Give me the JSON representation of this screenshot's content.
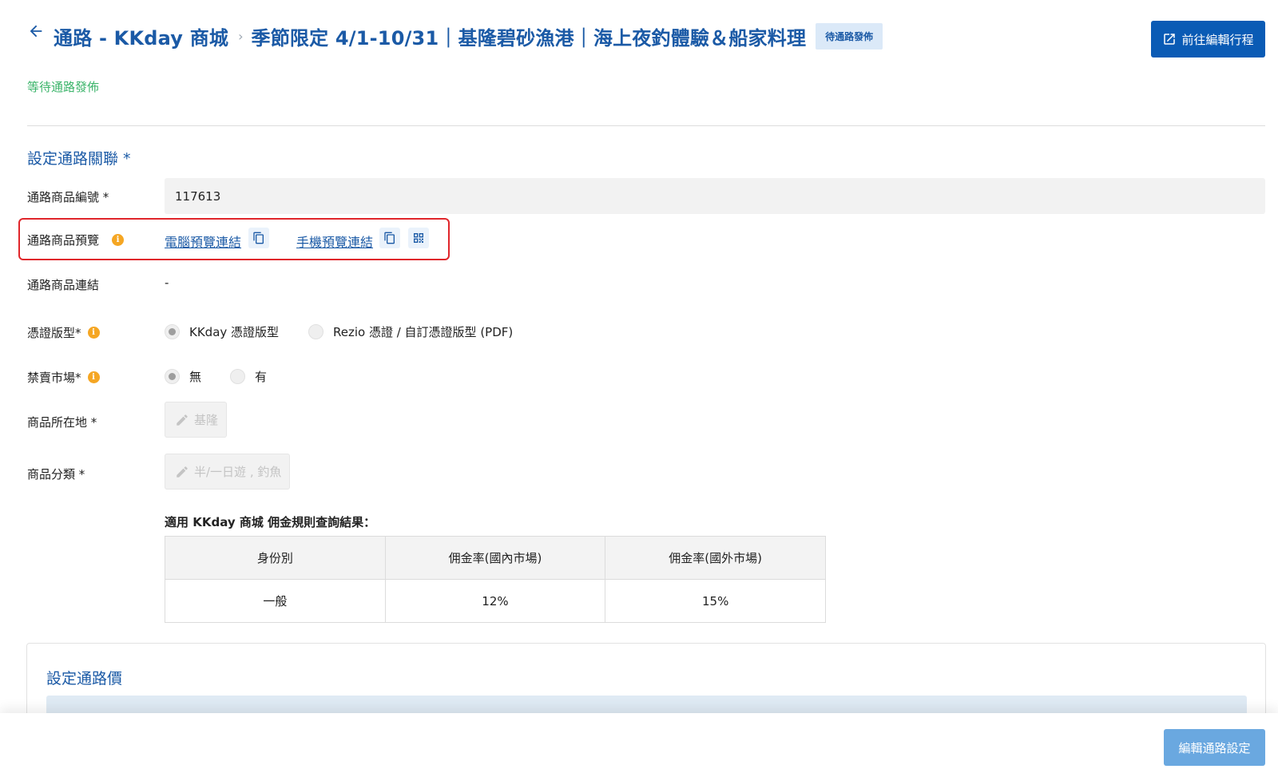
{
  "header": {
    "channel_title": "通路 - KKday 商城",
    "breadcrumb_separator": "›",
    "product_title": "季節限定 4/1-10/31｜基隆碧砂漁港｜海上夜釣體驗＆船家料理",
    "status_badge": "待通路發佈",
    "edit_itinerary_button": "前往編輯行程"
  },
  "status_text": "等待通路發佈",
  "channel_link_section": {
    "title": "設定通路關聯 *",
    "product_id": {
      "label": "通路商品編號 *",
      "value": "117613"
    },
    "preview": {
      "label": "通路商品預覽",
      "desktop_link": "電腦預覽連結",
      "mobile_link": "手機預覽連結"
    },
    "product_link": {
      "label": "通路商品連結",
      "value": "-"
    },
    "voucher_type": {
      "label": "憑證版型*",
      "options": [
        "KKday 憑證版型",
        "Rezio 憑證 / 自訂憑證版型 (PDF)"
      ],
      "selected": "KKday 憑證版型"
    },
    "restricted_market": {
      "label": "禁賣市場*",
      "options": [
        "無",
        "有"
      ],
      "selected": "無"
    },
    "location": {
      "label": "商品所在地 *",
      "value": "基隆"
    },
    "category": {
      "label": "商品分類 *",
      "value": "半/一日遊 , 釣魚"
    }
  },
  "commission": {
    "title": "適用 KKday 商城 佣金規則查詢結果：",
    "headers": [
      "身份別",
      "佣金率(國內市場)",
      "佣金率(國外市場)"
    ],
    "rows": [
      [
        "一般",
        "12%",
        "15%"
      ]
    ]
  },
  "price_section": {
    "title": "設定通路價"
  },
  "footer": {
    "edit_channel_button": "編輯通路設定"
  },
  "colors": {
    "primary": "#0a5bb5",
    "title_blue": "#1b5aa6",
    "status_green": "#3bb46a",
    "info_orange": "#f5a623",
    "highlight_red": "#e0262b",
    "footer_button": "#6aa8e0"
  },
  "icons": [
    "back-arrow-icon",
    "external-link-icon",
    "info-icon",
    "copy-icon",
    "qr-code-icon",
    "pencil-icon"
  ]
}
